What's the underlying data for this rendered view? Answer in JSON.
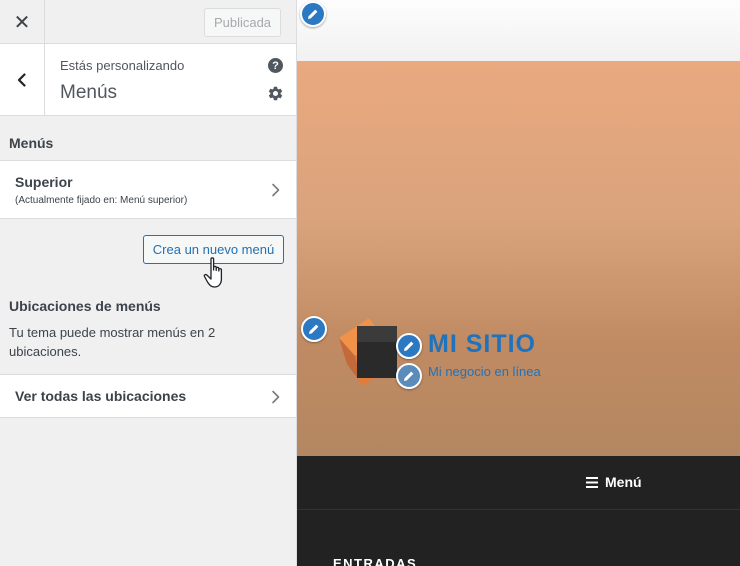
{
  "topbar": {
    "close_glyph": "✕",
    "publish_label": "Publicada"
  },
  "panel": {
    "subtitle": "Estás personalizando",
    "title": "Menús",
    "help_glyph": "?"
  },
  "menus": {
    "section_title": "Menús",
    "items": [
      {
        "name": "Superior",
        "description": "(Actualmente fijado en: Menú superior)"
      }
    ],
    "create_label": "Crea un nuevo menú"
  },
  "locations": {
    "title": "Ubicaciones de menús",
    "description": "Tu tema puede mostrar menús en 2 ubicaciones.",
    "view_all_label": "Ver todas las ubicaciones"
  },
  "preview": {
    "site_title": "MI SITIO",
    "site_tagline": "Mi negocio en línea",
    "menu_label": "Menú",
    "entries_heading": "ENTRADAS"
  },
  "icons": {
    "close": "close-icon",
    "back": "chevron-left-icon",
    "help": "help-icon",
    "gear": "gear-icon",
    "chevron": "chevron-right-icon",
    "edit": "pencil-icon",
    "cursor": "hand-cursor-icon",
    "menu": "hamburger-icon"
  },
  "colors": {
    "accent": "#2271b1",
    "site_title": "#1f73bd",
    "nav_bg": "#222222",
    "hero_top": "#eaa97f"
  }
}
